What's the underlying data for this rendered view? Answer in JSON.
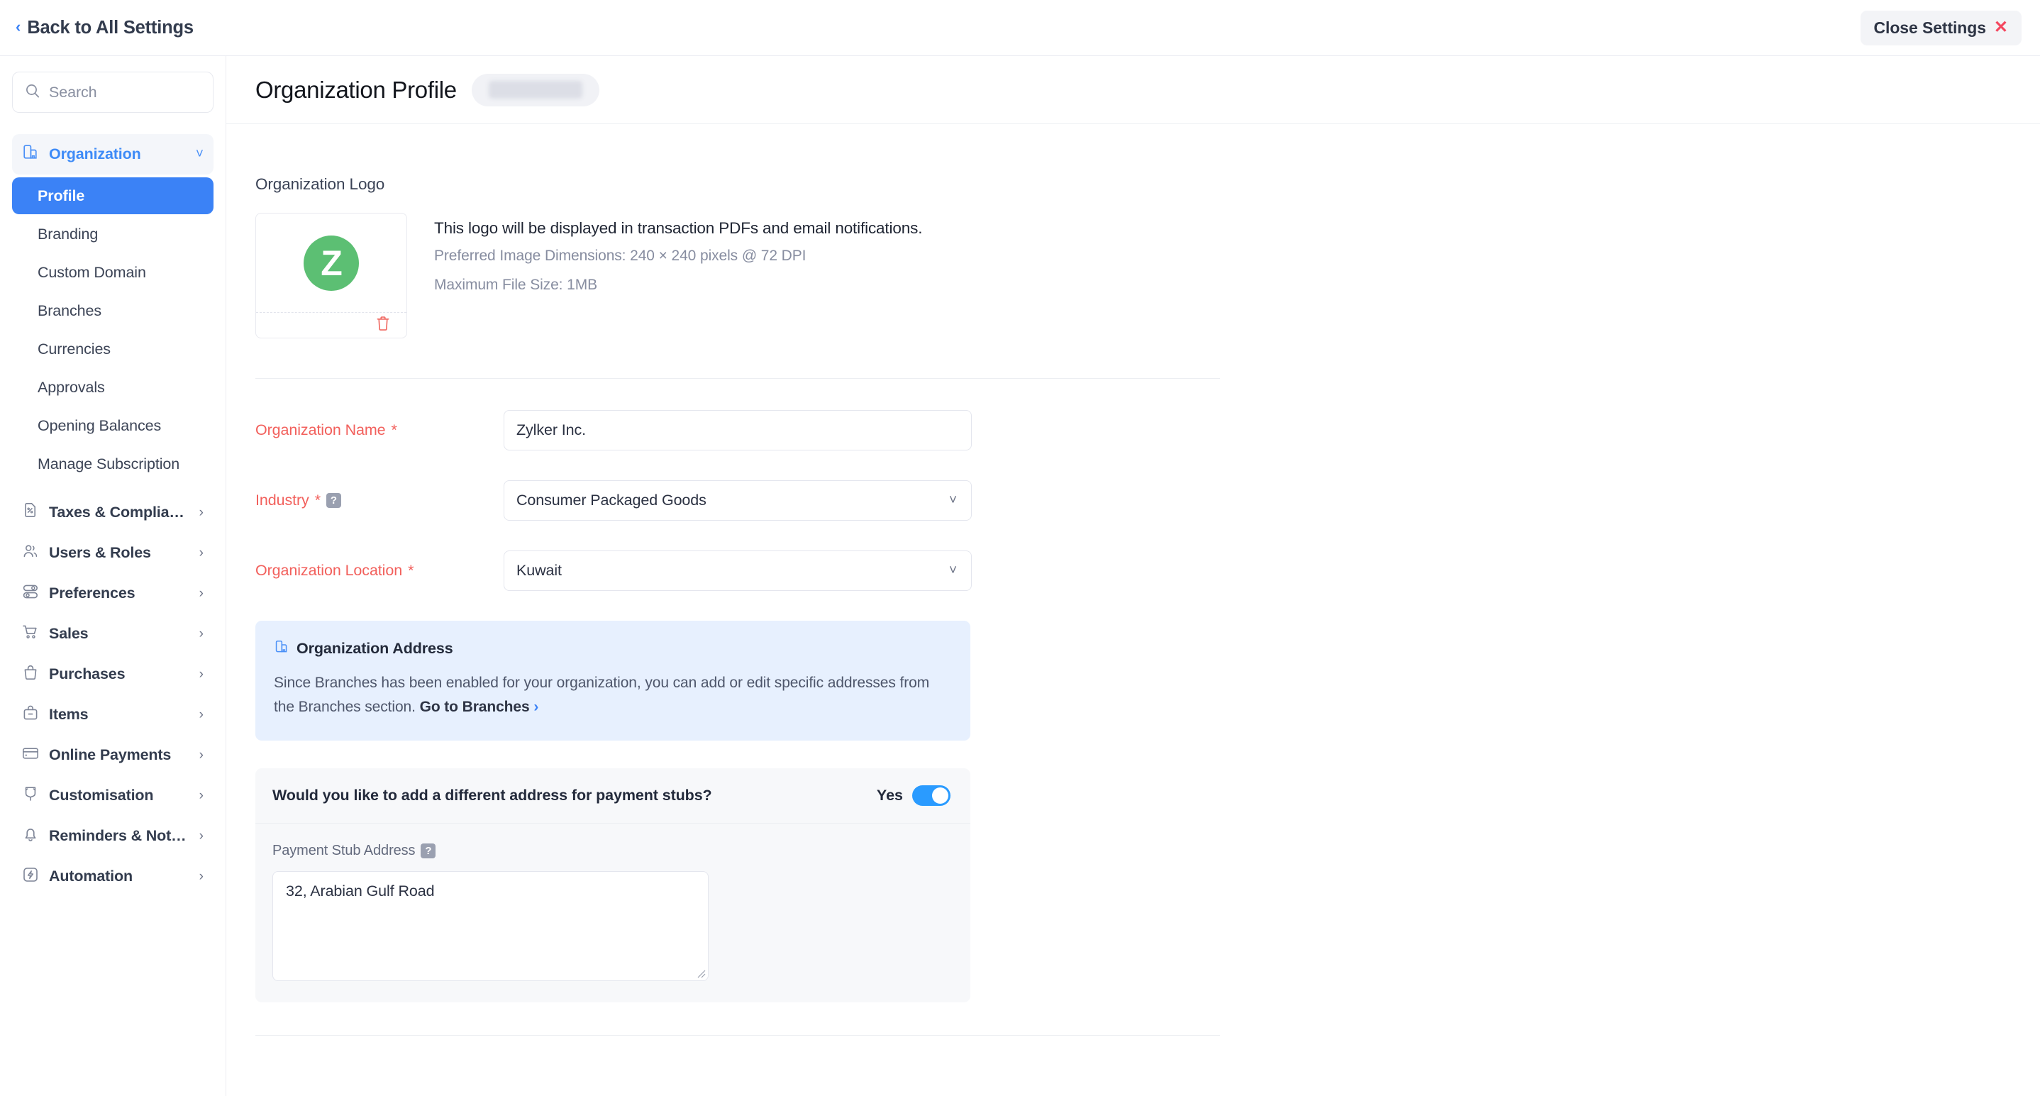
{
  "topbar": {
    "back_label": "Back to All Settings",
    "back_icon": "chevron-left-icon",
    "close_label": "Close Settings",
    "close_icon": "close-x-icon"
  },
  "sidebar": {
    "search": {
      "placeholder": "Search",
      "icon": "search-icon",
      "value": ""
    },
    "groups": [
      {
        "label": "Organization",
        "icon": "organization-icon",
        "expanded": true,
        "arrow": "chevron-down-icon",
        "items": [
          {
            "label": "Profile",
            "selected": true
          },
          {
            "label": "Branding",
            "selected": false
          },
          {
            "label": "Custom Domain",
            "selected": false
          },
          {
            "label": "Branches",
            "selected": false
          },
          {
            "label": "Currencies",
            "selected": false
          },
          {
            "label": "Approvals",
            "selected": false
          },
          {
            "label": "Opening Balances",
            "selected": false
          },
          {
            "label": "Manage Subscription",
            "selected": false
          }
        ]
      },
      {
        "label": "Taxes & Compliance",
        "icon": "tax-document-icon",
        "expanded": false,
        "arrow": "chevron-right-icon",
        "items": []
      },
      {
        "label": "Users & Roles",
        "icon": "users-icon",
        "expanded": false,
        "arrow": "chevron-right-icon",
        "items": []
      },
      {
        "label": "Preferences",
        "icon": "sliders-icon",
        "expanded": false,
        "arrow": "chevron-right-icon",
        "items": []
      },
      {
        "label": "Sales",
        "icon": "cart-icon",
        "expanded": false,
        "arrow": "chevron-right-icon",
        "items": []
      },
      {
        "label": "Purchases",
        "icon": "bag-icon",
        "expanded": false,
        "arrow": "chevron-right-icon",
        "items": []
      },
      {
        "label": "Items",
        "icon": "box-icon",
        "expanded": false,
        "arrow": "chevron-right-icon",
        "items": []
      },
      {
        "label": "Online Payments",
        "icon": "credit-card-icon",
        "expanded": false,
        "arrow": "chevron-right-icon",
        "items": []
      },
      {
        "label": "Customisation",
        "icon": "customisation-icon",
        "expanded": false,
        "arrow": "chevron-right-icon",
        "items": []
      },
      {
        "label": "Reminders & Notifica...",
        "icon": "bell-icon",
        "expanded": false,
        "arrow": "chevron-right-icon",
        "items": []
      },
      {
        "label": "Automation",
        "icon": "automation-bolt-icon",
        "expanded": false,
        "arrow": "chevron-right-icon",
        "items": []
      }
    ]
  },
  "page": {
    "title": "Organization Profile",
    "badge_redacted": true
  },
  "logo_section": {
    "label": "Organization Logo",
    "logo_letter": "Z",
    "logo_color": "#5CBF73",
    "delete_icon": "trash-icon",
    "description": "This logo will be displayed in transaction PDFs and email notifications.",
    "dimensions_note": "Preferred Image Dimensions: 240 × 240 pixels @ 72 DPI",
    "filesize_note": "Maximum File Size: 1MB"
  },
  "form": {
    "organization_name": {
      "label": "Organization Name",
      "required_marker": "*",
      "value": "Zylker Inc."
    },
    "industry": {
      "label": "Industry",
      "required_marker": "*",
      "help_icon": "help-question-icon",
      "value": "Consumer Packaged Goods",
      "chevron": "chevron-down-icon"
    },
    "organization_location": {
      "label": "Organization Location",
      "required_marker": "*",
      "value": "Kuwait",
      "chevron": "chevron-down-icon"
    }
  },
  "callout": {
    "icon": "organization-icon",
    "title": "Organization Address",
    "body": "Since Branches has been enabled for your organization, you can add or edit specific addresses from the Branches section. ",
    "link_text": "Go to Branches",
    "link_arrow": "›"
  },
  "payment_stub": {
    "question": "Would you like to add a different address for payment stubs?",
    "toggle_label": "Yes",
    "toggle_on": true,
    "field_label": "Payment Stub Address",
    "help_icon": "help-question-icon",
    "address_value": "32, Arabian Gulf Road"
  },
  "colors": {
    "accent_blue": "#3B82F6",
    "required_red": "#F2605C",
    "logo_green": "#5CBF73",
    "callout_bg": "#E7F0FE",
    "panel_bg": "#F7F8FA",
    "close_red": "#F4475F"
  }
}
